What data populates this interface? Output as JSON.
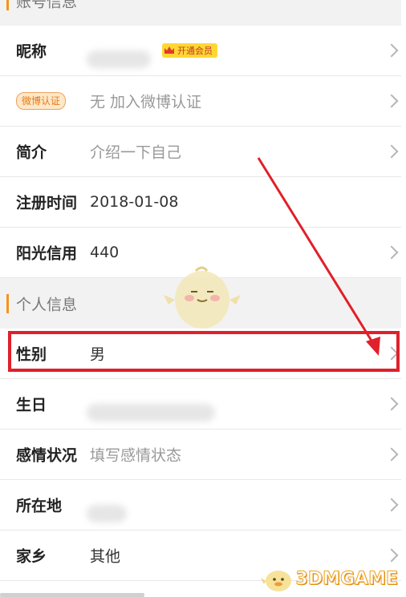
{
  "section_account": {
    "title": "账号信息"
  },
  "rows_account": {
    "nickname": {
      "label": "昵称",
      "vip": "开通会员"
    },
    "weibo": {
      "badge": "微博认证",
      "value": "无 加入微博认证"
    },
    "intro": {
      "label": "简介",
      "value": "介绍一下自己"
    },
    "register": {
      "label": "注册时间",
      "value": "2018-01-08"
    },
    "sunshine": {
      "label": "阳光信用",
      "value": "440"
    }
  },
  "section_personal": {
    "title": "个人信息"
  },
  "rows_personal": {
    "gender": {
      "label": "性别",
      "value": "男"
    },
    "birthday": {
      "label": "生日"
    },
    "relationship": {
      "label": "感情状况",
      "value": "填写感情状态"
    },
    "location": {
      "label": "所在地"
    },
    "hometown": {
      "label": "家乡",
      "value": "其他"
    }
  },
  "watermark": {
    "text": "3DMGAME"
  },
  "colors": {
    "accent": "#f7941d",
    "highlight": "#e0202a"
  }
}
